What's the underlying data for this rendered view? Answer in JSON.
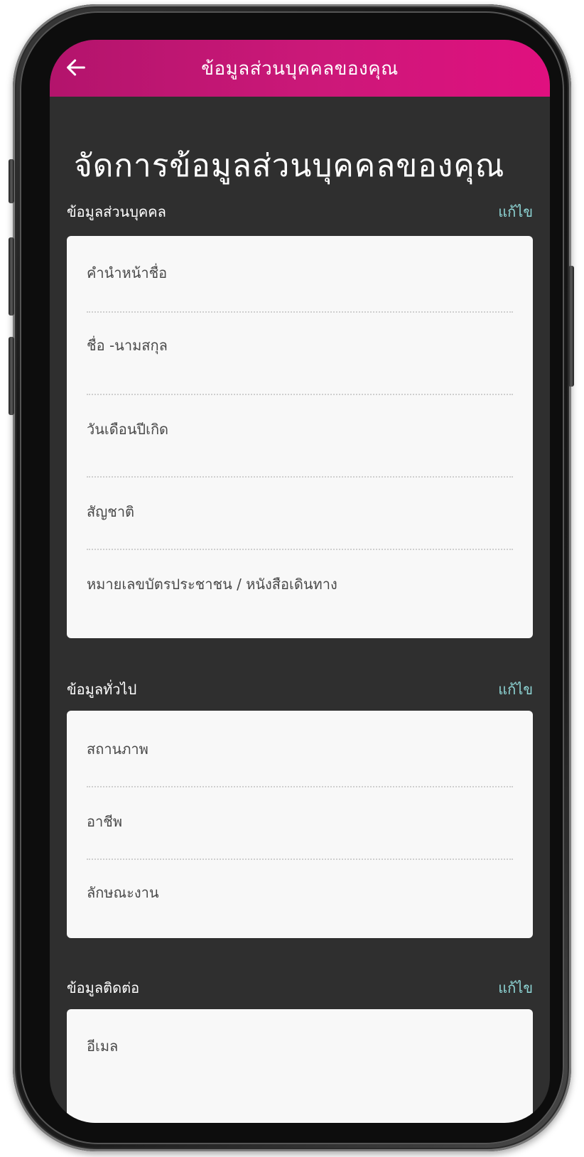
{
  "app_bar": {
    "title": "ข้อมูลส่วนบุคคลของคุณ",
    "back_icon": "arrow-left-icon"
  },
  "page": {
    "title": "จัดการข้อมูลส่วนบุคคลของคุณ"
  },
  "sections": [
    {
      "title": "ข้อมูลส่วนบุคคล",
      "edit_label": "แก้ไข",
      "fields": [
        "คำนำหน้าชื่อ",
        "ชื่อ -นามสกุล",
        "วันเดือนปีเกิด",
        "สัญชาติ",
        "หมายเลขบัตรประชาชน / หนังสือเดินทาง"
      ]
    },
    {
      "title": "ข้อมูลทั่วไป",
      "edit_label": "แก้ไข",
      "fields": [
        "สถานภาพ",
        "อาชีพ",
        "ลักษณะงาน"
      ]
    },
    {
      "title": "ข้อมูลติดต่อ",
      "edit_label": "แก้ไข",
      "fields": [
        "อีเมล"
      ]
    }
  ],
  "colors": {
    "app_bar_gradient_start": "#b3146c",
    "app_bar_gradient_end": "#e0107f",
    "screen_background": "#2f2f2f",
    "card_background": "#f8f8f8",
    "edit_link": "#8fd6d6"
  }
}
